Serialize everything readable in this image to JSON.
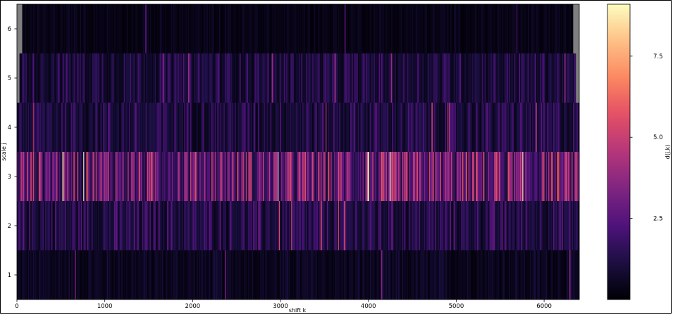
{
  "chart_data": {
    "type": "heatmap",
    "title": "",
    "xlabel": "shift k",
    "ylabel": "scale j",
    "colorbar_label": "d(j,k)",
    "colormap": "magma",
    "missing_color": "#808080",
    "xlim": [
      0,
      6400
    ],
    "x_ticks": [
      0,
      1000,
      2000,
      3000,
      4000,
      5000,
      6000
    ],
    "x_tick_labels": [
      "0",
      "1000",
      "2000",
      "3000",
      "4000",
      "5000",
      "6000"
    ],
    "rows": [
      1,
      2,
      3,
      4,
      5,
      6
    ],
    "row_tick_labels": [
      "1",
      "2",
      "3",
      "4",
      "5",
      "6"
    ],
    "row_extent": [
      {
        "scale": 1,
        "k_end": 6400
      },
      {
        "scale": 2,
        "k_end": 6400
      },
      {
        "scale": 3,
        "k_end": 6400
      },
      {
        "scale": 4,
        "k_end": 6400
      },
      {
        "scale": 5,
        "k_start": 30,
        "k_end": 6360
      },
      {
        "scale": 6,
        "k_start": 60,
        "k_end": 6330
      }
    ],
    "row_mean_value": [
      {
        "scale": 1,
        "mean": 0.6,
        "peak": 2.6
      },
      {
        "scale": 2,
        "mean": 1.5,
        "peak": 4.2
      },
      {
        "scale": 3,
        "mean": 3.2,
        "peak": 8.7
      },
      {
        "scale": 4,
        "mean": 1.4,
        "peak": 3.6
      },
      {
        "scale": 5,
        "mean": 1.3,
        "peak": 3.0
      },
      {
        "scale": 6,
        "mean": 0.4,
        "peak": 1.8
      }
    ],
    "peaks": [
      {
        "scale": 3,
        "shift": 790,
        "value": 5.8
      },
      {
        "scale": 3,
        "shift": 3990,
        "value": 8.7
      },
      {
        "scale": 3,
        "shift": 5450,
        "value": 5.5
      }
    ],
    "colorbar": {
      "vmin": 0,
      "vmax": 9.1,
      "ticks": [
        2.5,
        5.0,
        7.5
      ],
      "tick_labels": [
        "2.5",
        "5.0",
        "7.5"
      ]
    },
    "grid": false
  }
}
